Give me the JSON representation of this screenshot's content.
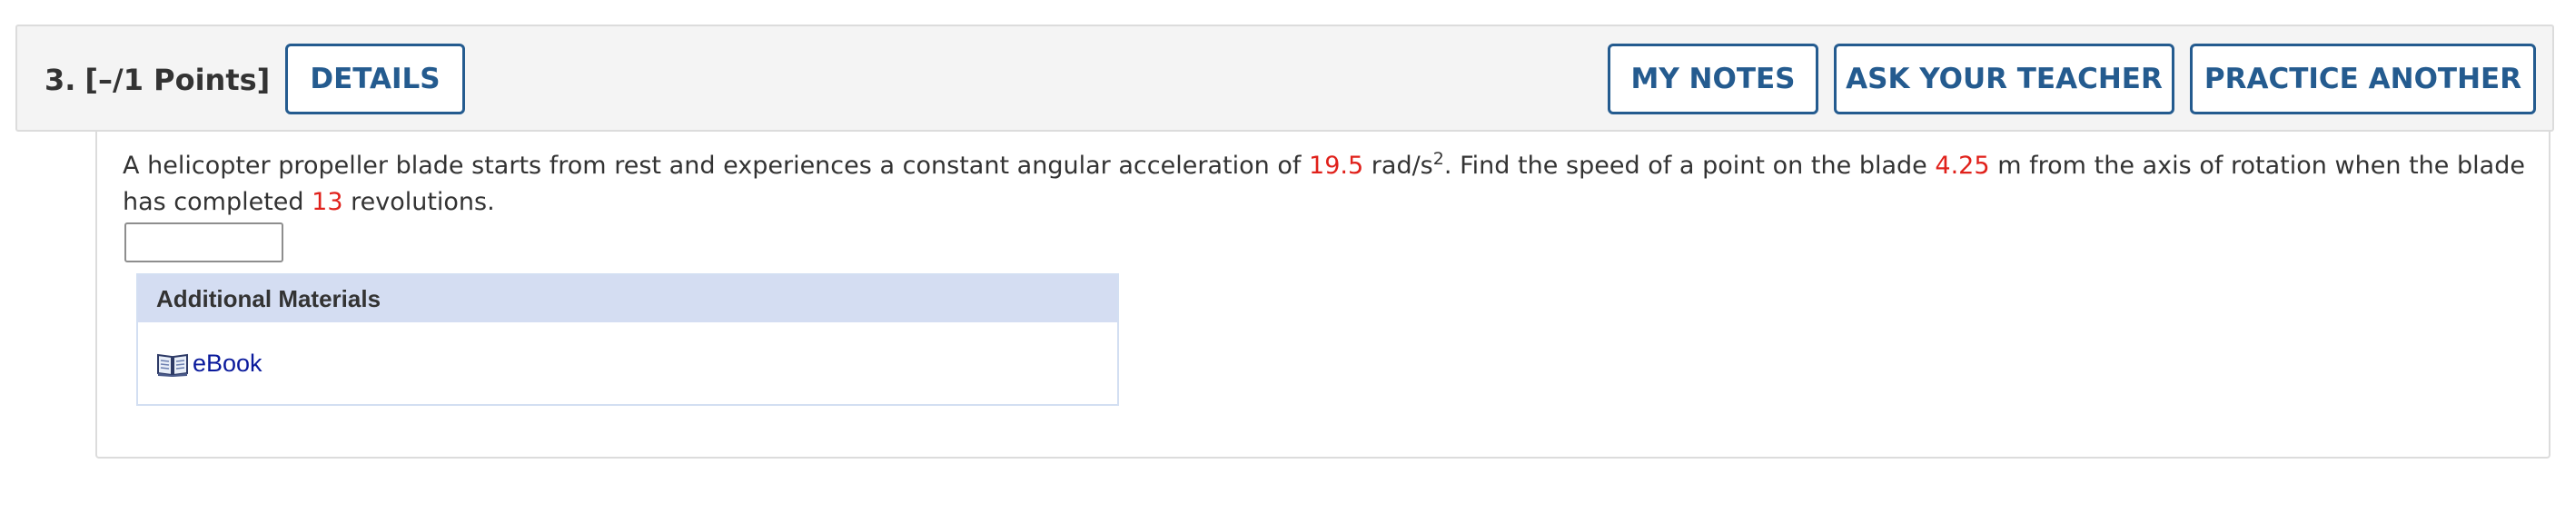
{
  "header": {
    "question_number": "3.",
    "points": "[–/1 Points]",
    "details_label": "DETAILS",
    "my_notes_label": "MY NOTES",
    "ask_teacher_label": "ASK YOUR TEACHER",
    "practice_label": "PRACTICE ANOTHER"
  },
  "question": {
    "text_1": "A helicopter propeller blade starts from rest and experiences a constant angular acceleration of ",
    "angular_acceleration": "19.5",
    "text_2": " rad/s",
    "exponent": "2",
    "text_3": ". Find the speed of a point on the blade ",
    "distance": "4.25",
    "text_4": " m from the axis of rotation when the blade has completed ",
    "revolutions": "13",
    "text_5": " revolutions.",
    "answer_value": ""
  },
  "materials": {
    "heading": "Additional Materials",
    "ebook_label": "eBook",
    "ebook_icon": "book-icon"
  },
  "colors": {
    "button_border": "#245b8f",
    "variable_highlight": "#e0211b",
    "materials_header_bg": "#d4ddf2",
    "link": "#0a1a9c"
  }
}
